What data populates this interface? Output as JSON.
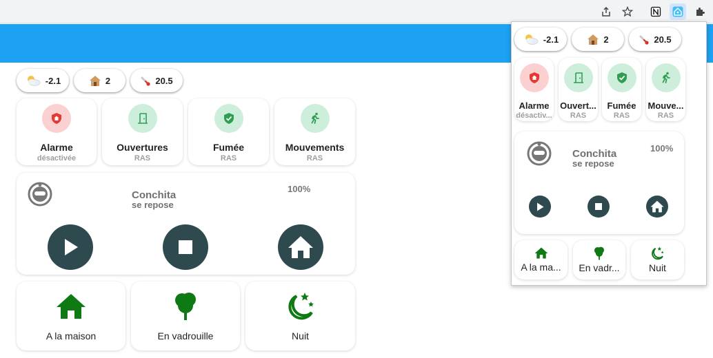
{
  "browser": {
    "icons": [
      "share-icon",
      "star-icon",
      "notion-icon",
      "home-assistant-icon",
      "puzzle-icon"
    ]
  },
  "chips": {
    "weather": "-2.1",
    "home": "2",
    "temperature": "20.5"
  },
  "status": {
    "alarm": {
      "title": "Alarme",
      "sub": "désactivée"
    },
    "openings": {
      "title": "Ouvertures",
      "sub": "RAS"
    },
    "smoke": {
      "title": "Fumée",
      "sub": "RAS"
    },
    "motion": {
      "title": "Mouvements",
      "sub": "RAS"
    }
  },
  "popup_status": {
    "alarm": {
      "title": "Alarme",
      "sub": "désactiv..."
    },
    "openings": {
      "title": "Ouvert...",
      "sub": "RAS"
    },
    "smoke": {
      "title": "Fumée",
      "sub": "RAS"
    },
    "motion": {
      "title": "Mouve...",
      "sub": "RAS"
    }
  },
  "vacuum": {
    "name": "Conchita",
    "state": "se repose",
    "battery": "100%"
  },
  "scenes": {
    "home": "A la maison",
    "out": "En vadrouille",
    "night": "Nuit"
  },
  "popup_scenes": {
    "home": "A la ma...",
    "out": "En vadr...",
    "night": "Nuit"
  },
  "colors": {
    "blue_bar": "#1da1f2",
    "alarm_bg": "#fbd0d0",
    "alarm_fg": "#e53935",
    "ok_bg": "#cdeedb",
    "ok_fg": "#2e9e52",
    "control": "#2e4a4f",
    "scene_icon": "#0f7a14"
  }
}
